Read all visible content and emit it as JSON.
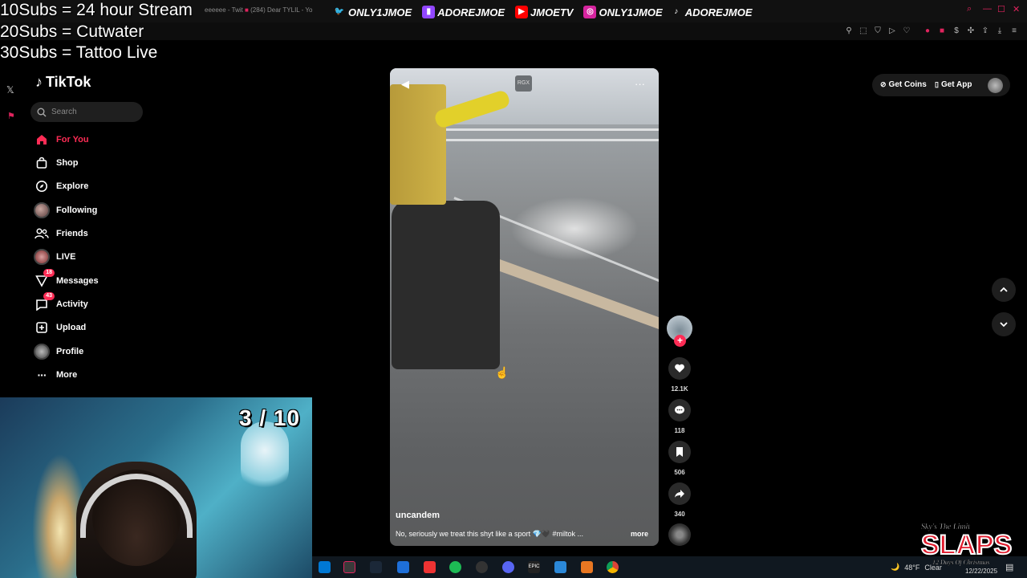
{
  "stream_overlay": {
    "goals": [
      "10Subs = 24 hour Stream",
      "20Subs = Cutwater",
      "30Subs = Tattoo Live"
    ],
    "socials": [
      "ONLY1JMOE",
      "ADOREJMOE",
      "JMOETV",
      "ONLY1JMOE",
      "ADOREJMOE"
    ],
    "webcam_counter": "3 / 10",
    "event_logo_main": "SLAPS",
    "event_logo_top": "Sky's The Limit",
    "event_logo_sub": "12 Days Of Christmas"
  },
  "browser": {
    "tabs": [
      "10Subs (...",
      "eeeeee - Twit",
      "(284) Dear TYLIL - Yo"
    ],
    "colors": {
      "accent": "#e0245e",
      "background": "#000000"
    }
  },
  "tiktok": {
    "logo": "TikTok",
    "search_placeholder": "Search",
    "nav": [
      {
        "label": "For You",
        "icon": "home-icon",
        "active": true
      },
      {
        "label": "Shop",
        "icon": "shop-bag-icon"
      },
      {
        "label": "Explore",
        "icon": "compass-icon"
      },
      {
        "label": "Following",
        "icon": "avatar"
      },
      {
        "label": "Friends",
        "icon": "friends-icon"
      },
      {
        "label": "LIVE",
        "icon": "avatar"
      },
      {
        "label": "Messages",
        "icon": "send-icon",
        "badge": "18"
      },
      {
        "label": "Activity",
        "icon": "inbox-icon",
        "badge": "43"
      },
      {
        "label": "Upload",
        "icon": "plus-square-icon"
      },
      {
        "label": "Profile",
        "icon": "avatar"
      },
      {
        "label": "More",
        "icon": "ellipsis-icon"
      }
    ],
    "header": {
      "get_coins": "Get Coins",
      "get_app": "Get App"
    },
    "video": {
      "watermark": "RGX",
      "username": "uncandem",
      "caption": "No, seriously we treat this shyt like a sport 💎🖤 #miltok ...",
      "more": "more"
    },
    "actions": {
      "likes": "12.1K",
      "comments": "118",
      "saves": "506",
      "shares": "340"
    },
    "colors": {
      "brand": "#fe2c55"
    }
  },
  "taskbar": {
    "weather": "48°F",
    "weather_desc": "Clear",
    "date": "12/22/2025"
  }
}
